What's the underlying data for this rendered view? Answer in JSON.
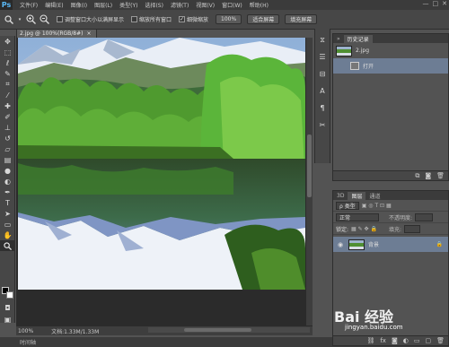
{
  "app": {
    "logo": "Ps"
  },
  "menu": [
    "文件(F)",
    "编辑(E)",
    "图像(I)",
    "图层(L)",
    "类型(Y)",
    "选择(S)",
    "滤镜(T)",
    "视图(V)",
    "窗口(W)",
    "帮助(H)"
  ],
  "window_controls": [
    "—",
    "□",
    "✕"
  ],
  "options": {
    "resize_windows": "调整窗口大小以满屏显示",
    "zoom_all": "缩放所有窗口",
    "scrubby_zoom": "细微缩放",
    "btn_100": "100%",
    "btn_fit": "适合屏幕",
    "btn_fill": "填充屏幕"
  },
  "document": {
    "tab_title": "2.jpg @ 100%(RGB/8#)",
    "close": "×"
  },
  "status": {
    "zoom": "100%",
    "doc_info": "文档:1.33M/1.33M"
  },
  "bottom_tab": "时间轴",
  "history": {
    "tabs": [
      "»",
      "历史记录"
    ],
    "snapshot_name": "2.jpg",
    "step": "打开"
  },
  "layers": {
    "tabs": [
      "3D",
      "图层",
      "通道"
    ],
    "filter": "ρ 类型",
    "blend_mode": "正常",
    "opacity_label": "不透明度:",
    "lock_label": "锁定:",
    "fill_label": "填充:",
    "background": "背景"
  },
  "watermark": {
    "text": "Bai 经验",
    "url": "jingyan.baidu.com"
  },
  "icons": {
    "zoom": "🔍",
    "eye": "👁",
    "lock": "🔒"
  }
}
